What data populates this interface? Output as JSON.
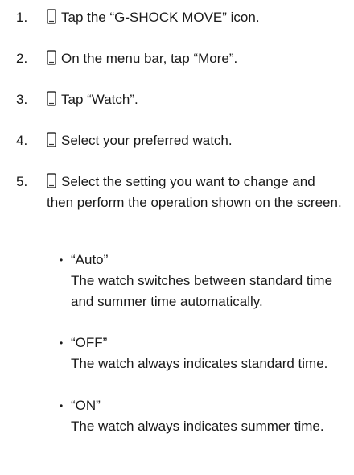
{
  "steps": [
    {
      "number": "1.",
      "text": "Tap the “G-SHOCK MOVE” icon.",
      "icon": "phone-icon"
    },
    {
      "number": "2.",
      "text": "On the menu bar, tap “More”.",
      "icon": "phone-icon"
    },
    {
      "number": "3.",
      "text": "Tap “Watch”.",
      "icon": "phone-icon"
    },
    {
      "number": "4.",
      "text": "Select your preferred watch.",
      "icon": "phone-icon"
    },
    {
      "number": "5.",
      "text": "Select the setting you want to change and then perform the operation shown on the screen.",
      "icon": "phone-icon"
    }
  ],
  "options": [
    {
      "name": "“Auto”",
      "description": "The watch switches between standard time and summer time automatically."
    },
    {
      "name": "“OFF”",
      "description": "The watch always indicates standard time."
    },
    {
      "name": "“ON”",
      "description": "The watch always indicates summer time."
    }
  ],
  "bullet_glyph": "•"
}
